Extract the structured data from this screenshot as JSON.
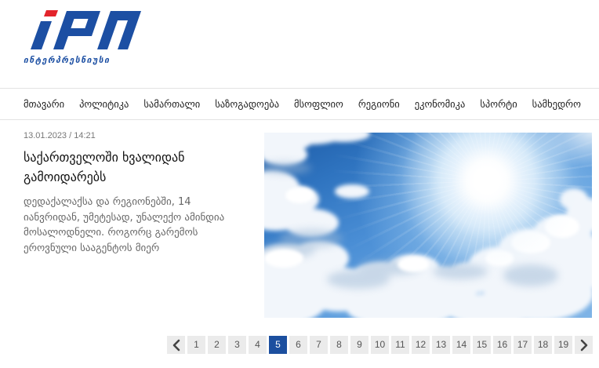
{
  "site": {
    "logo": {
      "text": "IPN",
      "subtitle": "ინტერპრესნიუსი"
    },
    "colors": {
      "brand_blue": "#1c4fa3",
      "brand_red": "#e3242b"
    }
  },
  "nav": {
    "items": [
      "მთავარი",
      "პოლიტიკა",
      "სამართალი",
      "საზოგადოება",
      "მსოფლიო",
      "რეგიონი",
      "ეკონომიკა",
      "სპორტი",
      "სამხედრო"
    ]
  },
  "article": {
    "datetime": "13.01.2023 / 14:21",
    "title": "საქართველოში ხვალიდან გამოიდარებს",
    "description_lines": [
      "დედაქალაქსა და რეგიონებში, 14",
      "იანვრიდან, უმეტესად, უნალექო ამინდია",
      "მოსალოდნელი. როგორც გარემოს",
      "ეროვნული სააგენტოს მიერ"
    ]
  },
  "pagination": {
    "prev_icon": "chevron-left-icon",
    "next_icon": "chevron-right-icon",
    "pages": [
      "1",
      "2",
      "3",
      "4",
      "5",
      "6",
      "7",
      "8",
      "9",
      "10",
      "11",
      "12",
      "13",
      "14",
      "15",
      "16",
      "17",
      "18",
      "19"
    ],
    "current_page": 5,
    "active_color": "#1c4f9f"
  }
}
